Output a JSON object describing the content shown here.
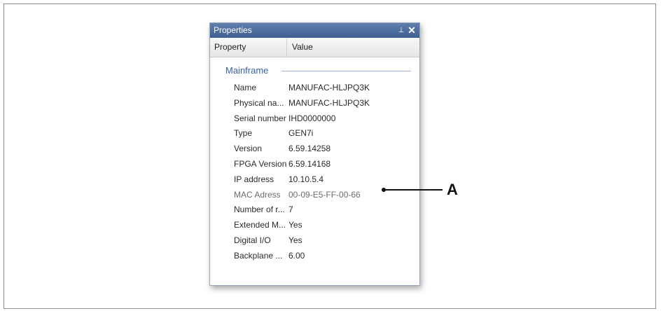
{
  "panel": {
    "title": "Properties",
    "pin_glyph": "⊥",
    "close_glyph": "✕"
  },
  "header": {
    "property_col": "Property",
    "value_col": "Value"
  },
  "group": {
    "title": "Mainframe",
    "rows": [
      {
        "key": "Name",
        "value": "MANUFAC-HLJPQ3K"
      },
      {
        "key": "Physical na...",
        "value": "MANUFAC-HLJPQ3K"
      },
      {
        "key": "Serial number",
        "value": "IHD0000000"
      },
      {
        "key": "Type",
        "value": "GEN7i"
      },
      {
        "key": "Version",
        "value": "6.59.14258"
      },
      {
        "key": "FPGA Version",
        "value": "6.59.14168"
      },
      {
        "key": "IP address",
        "value": "10.10.5.4"
      },
      {
        "key": "MAC Adress",
        "value": "00-09-E5-FF-00-66"
      },
      {
        "key": "Number of r...",
        "value": "7"
      },
      {
        "key": "Extended M...",
        "value": "Yes"
      },
      {
        "key": "Digital I/O",
        "value": "Yes"
      },
      {
        "key": "Backplane ...",
        "value": "6.00"
      }
    ]
  },
  "callout": {
    "label": "A"
  }
}
